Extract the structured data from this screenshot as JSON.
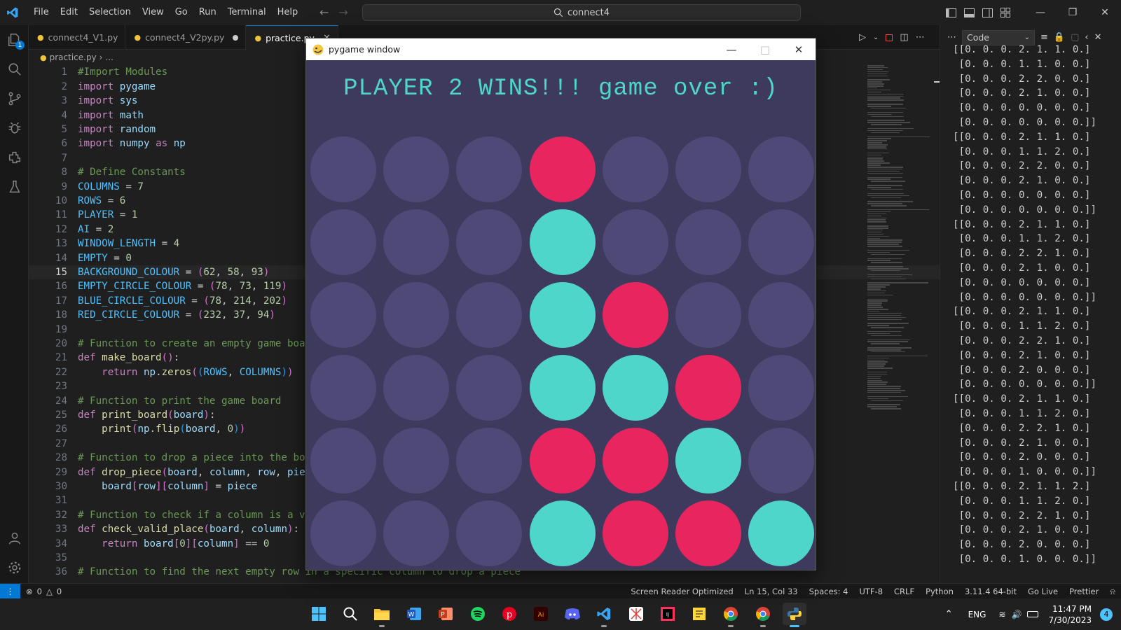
{
  "titlebar": {
    "menu": [
      "File",
      "Edit",
      "Selection",
      "View",
      "Go",
      "Run",
      "Terminal",
      "Help"
    ],
    "search_text": "connect4"
  },
  "activity": {
    "explorer_badge": "1"
  },
  "tabs": [
    {
      "label": "connect4_V1.py",
      "active": false,
      "dirty": false
    },
    {
      "label": "connect4_V2py.py",
      "active": false,
      "dirty": true
    },
    {
      "label": "practice.py",
      "active": true,
      "dirty": false
    }
  ],
  "breadcrumb": {
    "file": "practice.py",
    "rest": "..."
  },
  "editor": {
    "current_line": 15,
    "lines": [
      {
        "n": "1",
        "text": "#Import Modules"
      },
      {
        "n": "2",
        "text": "import pygame"
      },
      {
        "n": "3",
        "text": "import sys"
      },
      {
        "n": "4",
        "text": "import math"
      },
      {
        "n": "5",
        "text": "import random"
      },
      {
        "n": "6",
        "text": "import numpy as np"
      },
      {
        "n": "7",
        "text": ""
      },
      {
        "n": "8",
        "text": "# Define Constants"
      },
      {
        "n": "9",
        "text": "COLUMNS = 7"
      },
      {
        "n": "10",
        "text": "ROWS = 6"
      },
      {
        "n": "11",
        "text": "PLAYER = 1"
      },
      {
        "n": "12",
        "text": "AI = 2"
      },
      {
        "n": "13",
        "text": "WINDOW_LENGTH = 4"
      },
      {
        "n": "14",
        "text": "EMPTY = 0"
      },
      {
        "n": "15",
        "text": "BACKGROUND_COLOUR = (62, 58, 93)"
      },
      {
        "n": "16",
        "text": "EMPTY_CIRCLE_COLOUR = (78, 73, 119)"
      },
      {
        "n": "17",
        "text": "BLUE_CIRCLE_COLOUR = (78, 214, 202)"
      },
      {
        "n": "18",
        "text": "RED_CIRCLE_COLOUR = (232, 37, 94)"
      },
      {
        "n": "19",
        "text": ""
      },
      {
        "n": "20",
        "text": "# Function to create an empty game board"
      },
      {
        "n": "21",
        "text": "def make_board():"
      },
      {
        "n": "22",
        "text": "    return np.zeros((ROWS, COLUMNS))"
      },
      {
        "n": "23",
        "text": ""
      },
      {
        "n": "24",
        "text": "# Function to print the game board"
      },
      {
        "n": "25",
        "text": "def print_board(board):"
      },
      {
        "n": "26",
        "text": "    print(np.flip(board, 0))"
      },
      {
        "n": "27",
        "text": ""
      },
      {
        "n": "28",
        "text": "# Function to drop a piece into the board"
      },
      {
        "n": "29",
        "text": "def drop_piece(board, column, row, piece):"
      },
      {
        "n": "30",
        "text": "    board[row][column] = piece"
      },
      {
        "n": "31",
        "text": ""
      },
      {
        "n": "32",
        "text": "# Function to check if a column is a valid place"
      },
      {
        "n": "33",
        "text": "def check_valid_place(board, column):"
      },
      {
        "n": "34",
        "text": "    return board[0][column] == 0"
      },
      {
        "n": "35",
        "text": ""
      },
      {
        "n": "36",
        "text": "# Function to find the next empty row in a specific column to drop a piece"
      }
    ]
  },
  "output": {
    "channel": "Code",
    "lines": [
      "[[0. 0. 0. 2. 1. 1. 0.]",
      " [0. 0. 0. 1. 1. 0. 0.]",
      " [0. 0. 0. 2. 2. 0. 0.]",
      " [0. 0. 0. 2. 1. 0. 0.]",
      " [0. 0. 0. 0. 0. 0. 0.]",
      " [0. 0. 0. 0. 0. 0. 0.]]",
      "[[0. 0. 0. 2. 1. 1. 0.]",
      " [0. 0. 0. 1. 1. 2. 0.]",
      " [0. 0. 0. 2. 2. 0. 0.]",
      " [0. 0. 0. 2. 1. 0. 0.]",
      " [0. 0. 0. 0. 0. 0. 0.]",
      " [0. 0. 0. 0. 0. 0. 0.]]",
      "[[0. 0. 0. 2. 1. 1. 0.]",
      " [0. 0. 0. 1. 1. 2. 0.]",
      " [0. 0. 0. 2. 2. 1. 0.]",
      " [0. 0. 0. 2. 1. 0. 0.]",
      " [0. 0. 0. 0. 0. 0. 0.]",
      " [0. 0. 0. 0. 0. 0. 0.]]",
      "[[0. 0. 0. 2. 1. 1. 0.]",
      " [0. 0. 0. 1. 1. 2. 0.]",
      " [0. 0. 0. 2. 2. 1. 0.]",
      " [0. 0. 0. 2. 1. 0. 0.]",
      " [0. 0. 0. 2. 0. 0. 0.]",
      " [0. 0. 0. 0. 0. 0. 0.]]",
      "[[0. 0. 0. 2. 1. 1. 0.]",
      " [0. 0. 0. 1. 1. 2. 0.]",
      " [0. 0. 0. 2. 2. 1. 0.]",
      " [0. 0. 0. 2. 1. 0. 0.]",
      " [0. 0. 0. 2. 0. 0. 0.]",
      " [0. 0. 0. 1. 0. 0. 0.]]",
      "[[0. 0. 0. 2. 1. 1. 2.]",
      " [0. 0. 0. 1. 1. 2. 0.]",
      " [0. 0. 0. 2. 2. 1. 0.]",
      " [0. 0. 0. 2. 1. 0. 0.]",
      " [0. 0. 0. 2. 0. 0. 0.]",
      " [0. 0. 0. 1. 0. 0. 0.]]"
    ]
  },
  "statusbar": {
    "errors": "0",
    "warnings": "0",
    "items": [
      "Screen Reader Optimized",
      "Ln 15, Col 33",
      "Spaces: 4",
      "UTF-8",
      "CRLF",
      "Python",
      "3.11.4 64-bit",
      "Go Live",
      "Prettier"
    ]
  },
  "pygame": {
    "window_title": "pygame window",
    "message": "PLAYER 2 WINS!!! game over :)",
    "colors": {
      "background": "#3e3a5d",
      "empty": "#4e4977",
      "blue": "#4ed6ca",
      "red": "#e8255e"
    },
    "board_top_to_bottom": [
      [
        0,
        0,
        0,
        1,
        0,
        0,
        0
      ],
      [
        0,
        0,
        0,
        2,
        0,
        0,
        0
      ],
      [
        0,
        0,
        0,
        2,
        1,
        0,
        0
      ],
      [
        0,
        0,
        0,
        2,
        2,
        1,
        0
      ],
      [
        0,
        0,
        0,
        1,
        1,
        2,
        0
      ],
      [
        0,
        0,
        0,
        2,
        1,
        1,
        2
      ]
    ]
  },
  "taskbar": {
    "apps": [
      "start",
      "search",
      "file-explorer",
      "word",
      "powerpoint",
      "spotify",
      "pinterest",
      "illustrator",
      "discord",
      "vscode",
      "mindmap",
      "intellij",
      "sticky",
      "chrome-1",
      "chrome-2",
      "python"
    ],
    "lang": "ENG",
    "time": "11:47 PM",
    "date": "7/30/2023",
    "notifications": "4"
  }
}
